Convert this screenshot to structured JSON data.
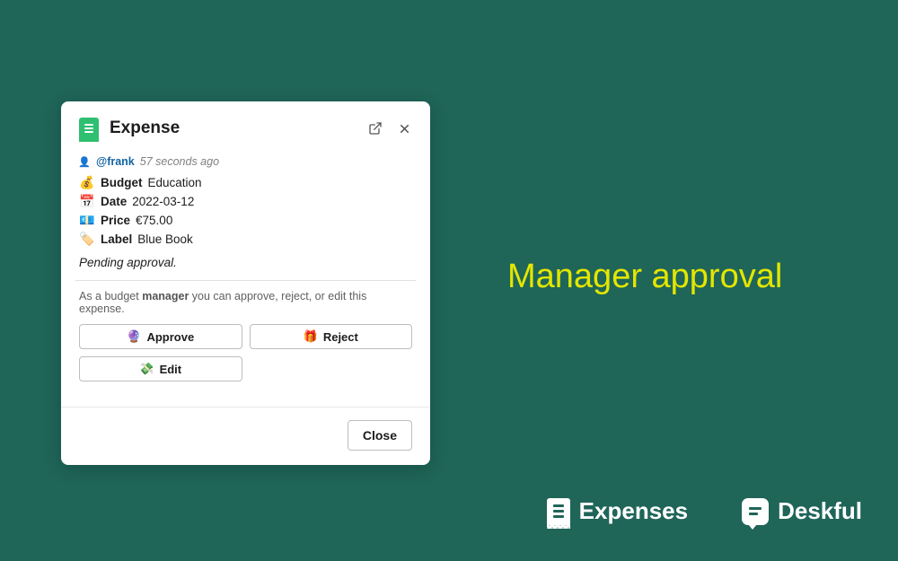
{
  "modal": {
    "title": "Expense",
    "user": "@frank",
    "timestamp": "57 seconds ago",
    "fields": {
      "budget": {
        "icon": "💰",
        "label": "Budget",
        "value": "Education"
      },
      "date": {
        "icon": "📅",
        "label": "Date",
        "value": "2022-03-12"
      },
      "price": {
        "icon": "💶",
        "label": "Price",
        "value": "€75.00"
      },
      "label": {
        "icon": "🏷️",
        "label": "Label",
        "value": "Blue Book"
      }
    },
    "status": "Pending approval.",
    "helper_pre": "As a budget ",
    "helper_bold": "manager",
    "helper_post": " you can approve, reject, or edit this expense.",
    "actions": {
      "approve": "Approve",
      "reject": "Reject",
      "edit": "Edit"
    },
    "close": "Close"
  },
  "headline": "Manager approval",
  "brands": {
    "expenses": "Expenses",
    "deskful": "Deskful"
  }
}
